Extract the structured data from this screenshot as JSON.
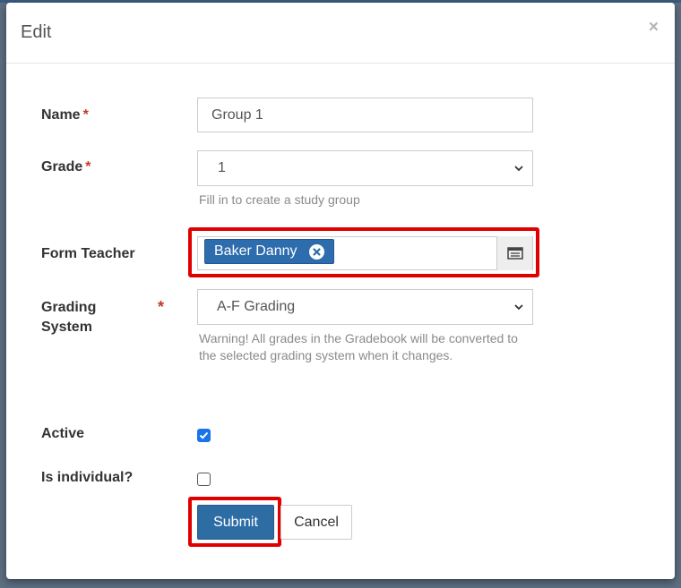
{
  "modal": {
    "title": "Edit",
    "close_label": "×"
  },
  "form": {
    "name": {
      "label": "Name",
      "required_mark": "*",
      "value": "Group 1"
    },
    "grade": {
      "label": "Grade",
      "required_mark": "*",
      "value": "1",
      "help": "Fill in to create a study group"
    },
    "form_teacher": {
      "label": "Form Teacher",
      "selected_tag": "Baker Danny",
      "picker_icon": "list-picker-icon"
    },
    "grading_system": {
      "label_line1": "Grading",
      "label_line2": "System",
      "required_mark": "*",
      "value": "A-F Grading",
      "warning_line1": "Warning! All grades in the Gradebook will be converted to",
      "warning_line2": "the selected grading system when it changes."
    },
    "active": {
      "label": "Active",
      "checked": true
    },
    "is_individual": {
      "label": "Is individual?",
      "checked": false
    }
  },
  "buttons": {
    "submit": "Submit",
    "cancel": "Cancel"
  },
  "colors": {
    "required": "#c23b22",
    "primary": "#2e6da4",
    "highlight": "#e00000",
    "checkbox_checked": "#1a73e8"
  }
}
